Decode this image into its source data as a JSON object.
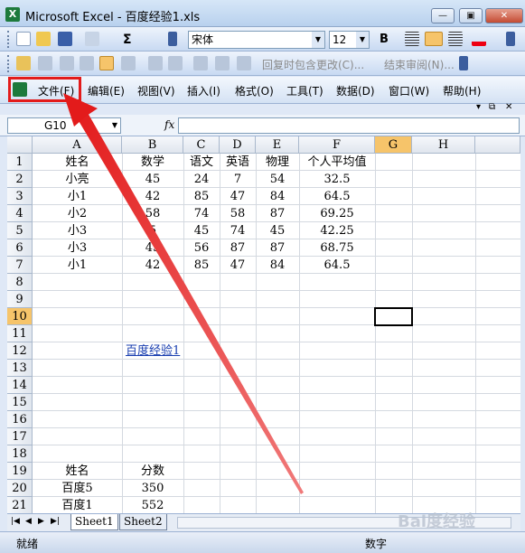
{
  "window": {
    "title": "Microsoft Excel - 百度经验1.xls",
    "logo": "X",
    "minimize": "—",
    "restore": "▣",
    "close": "✕"
  },
  "toolbar": {
    "font_name": "宋体",
    "font_size": "12",
    "bold": "B",
    "sigma": "Σ",
    "review_text": "回复时包含更改(C)...",
    "end_review": "结束审阅(N)..."
  },
  "menu": {
    "items": [
      "文件(F)",
      "编辑(E)",
      "视图(V)",
      "插入(I)",
      "格式(O)",
      "工具(T)",
      "数据(D)",
      "窗口(W)",
      "帮助(H)"
    ]
  },
  "formula_bar": {
    "name_box": "G10",
    "fx": "fx",
    "value": ""
  },
  "grid": {
    "columns": [
      "A",
      "B",
      "C",
      "D",
      "E",
      "F",
      "G",
      "H"
    ],
    "selected_column": "G",
    "rows": [
      "1",
      "2",
      "3",
      "4",
      "5",
      "6",
      "7",
      "8",
      "9",
      "10",
      "11",
      "12",
      "13",
      "14",
      "15",
      "16",
      "17",
      "18",
      "19",
      "20",
      "21"
    ],
    "selected_row": "10",
    "active_cell": "G10",
    "data": {
      "r1": [
        "姓名",
        "数学",
        "语文",
        "英语",
        "物理",
        "个人平均值"
      ],
      "r2": [
        "小亮",
        "45",
        "24",
        "7",
        "54",
        "32.5"
      ],
      "r3": [
        "小1",
        "42",
        "85",
        "47",
        "84",
        "64.5"
      ],
      "r4": [
        "小2",
        "58",
        "74",
        "58",
        "87",
        "69.25"
      ],
      "r5": [
        "小3",
        "5",
        "45",
        "74",
        "45",
        "42.25"
      ],
      "r6": [
        "小3",
        "45",
        "56",
        "87",
        "87",
        "68.75"
      ],
      "r7": [
        "小1",
        "42",
        "85",
        "47",
        "84",
        "64.5"
      ],
      "link_b12": "百度经验1",
      "r19": [
        "姓名",
        "分数"
      ],
      "r20": [
        "百度5",
        "350"
      ],
      "r21": [
        "百度1",
        "552"
      ]
    }
  },
  "sheets": {
    "tabs": [
      "Sheet1",
      "Sheet2"
    ],
    "active": "Sheet1"
  },
  "status": {
    "left": "就绪",
    "right": "数字"
  },
  "watermark": "Bai度经验",
  "colors": {
    "highlight": "#e31b1b",
    "selected_header": "#f6c46a",
    "link": "#1a3fb0"
  }
}
